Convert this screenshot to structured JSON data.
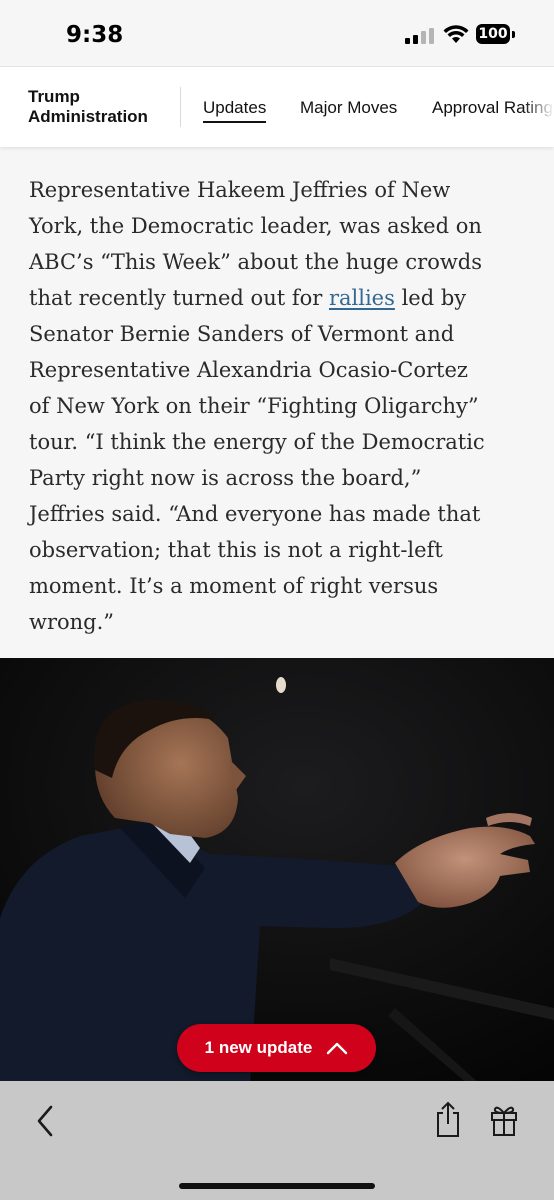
{
  "status_bar": {
    "time": "9:38",
    "battery": "100",
    "icons": [
      "signal-icon",
      "wifi-icon",
      "battery-icon"
    ]
  },
  "nav": {
    "section_title_line1": "Trump",
    "section_title_line2": "Administration",
    "tabs": [
      {
        "label": "Updates",
        "active": true
      },
      {
        "label": "Major Moves",
        "active": false
      },
      {
        "label": "Approval Rating",
        "active": false
      }
    ]
  },
  "article": {
    "lines": [
      "Representative Hakeem Jeffries of New",
      "York, the Democratic leader, was asked on",
      "ABC’s “This Week” about the huge crowds",
      "that recently turned out for ",
      "Senator Bernie Sanders of Vermont and",
      "Representative Alexandria Ocasio-Cortez",
      "of New York on their “Fighting Oligarchy”",
      "tour. “I think the energy of the Democratic",
      "Party right now is across the board,”",
      "Jeffries said. “And everyone has made that",
      "observation; that this is not a right-left",
      "moment. It’s a moment of right versus",
      "wrong.”"
    ],
    "link_text": "rallies",
    "after_link": " led by",
    "link_color": "#326891"
  },
  "update_pill": {
    "label": "1 new update",
    "icon": "chevron-up-icon",
    "color": "#d0021b"
  },
  "toolbar": {
    "icons": [
      "back-chevron-icon",
      "share-icon",
      "gift-icon"
    ]
  }
}
